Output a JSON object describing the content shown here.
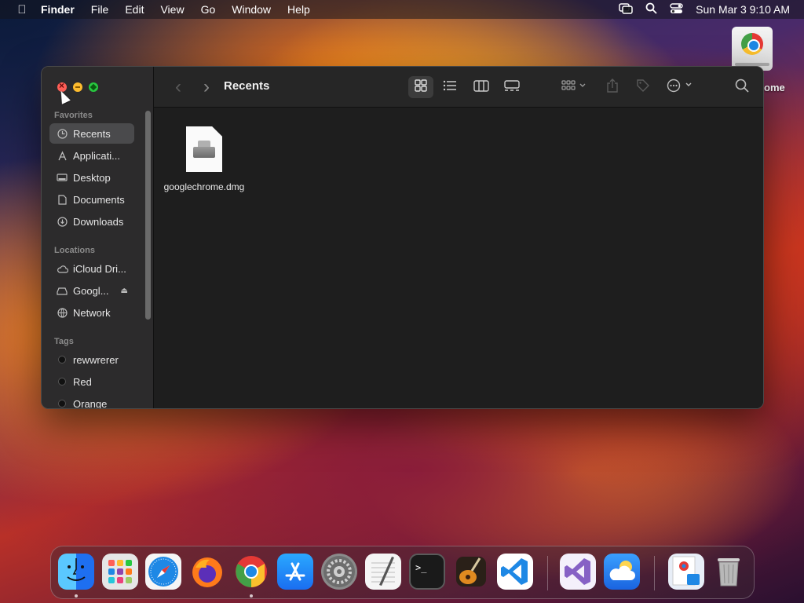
{
  "menubar": {
    "apple_icon": "apple-icon",
    "app_name": "Finder",
    "items": [
      "File",
      "Edit",
      "View",
      "Go",
      "Window",
      "Help"
    ],
    "status_icons": [
      "windows-icon",
      "search-icon",
      "control-center-icon"
    ],
    "clock": "Sun Mar 3  9:10 AM"
  },
  "desktop": {
    "icon_label": "rome",
    "icon": "googlechrome-disk-icon"
  },
  "finder": {
    "title": "Recents",
    "sidebar": {
      "favorites_header": "Favorites",
      "favorites": [
        {
          "label": "Recents",
          "icon": "clock-icon"
        },
        {
          "label": "Applicati...",
          "icon": "applications-icon"
        },
        {
          "label": "Desktop",
          "icon": "desktop-icon"
        },
        {
          "label": "Documents",
          "icon": "document-icon"
        },
        {
          "label": "Downloads",
          "icon": "downloads-icon"
        }
      ],
      "locations_header": "Locations",
      "locations": [
        {
          "label": "iCloud Dri...",
          "icon": "cloud-icon"
        },
        {
          "label": "Googl...",
          "icon": "disk-icon",
          "eject": "eject-icon"
        },
        {
          "label": "Network",
          "icon": "network-icon"
        }
      ],
      "tags_header": "Tags",
      "tags": [
        {
          "label": "rewwrerer",
          "color": "#1a1a1a"
        },
        {
          "label": "Red",
          "color": "#1a1a1a"
        },
        {
          "label": "Orange",
          "color": "#1a1a1a"
        }
      ]
    },
    "toolbar": {
      "back": "‹",
      "forward": "›",
      "view_buttons": [
        "icon-view-icon",
        "list-view-icon",
        "column-view-icon",
        "gallery-view-icon"
      ],
      "group_icon": "group-icon",
      "share_icon": "share-icon",
      "tag_icon": "tag-icon",
      "more_icon": "more-icon",
      "search_icon": "search-icon"
    },
    "files": [
      {
        "name": "googlechrome.dmg",
        "icon": "dmg-file-icon"
      }
    ]
  },
  "dock": {
    "apps": [
      {
        "name": "Finder",
        "running": true,
        "color": "#1e7cf2"
      },
      {
        "name": "Launchpad",
        "running": false,
        "color": "#d9d9d9"
      },
      {
        "name": "Safari",
        "running": false,
        "color": "#2a8cf5"
      },
      {
        "name": "Firefox",
        "running": false,
        "color": "#ff7a1a"
      },
      {
        "name": "Google Chrome",
        "running": true,
        "color": "#ffffff"
      },
      {
        "name": "App Store",
        "running": false,
        "color": "#1b8cf5"
      },
      {
        "name": "System Settings",
        "running": false,
        "color": "#8a8a8a"
      },
      {
        "name": "TextEdit",
        "running": false,
        "color": "#f5f5f5"
      },
      {
        "name": "Terminal",
        "running": false,
        "color": "#1a1a1a"
      },
      {
        "name": "GarageBand",
        "running": false,
        "color": "#3a2a1a"
      },
      {
        "name": "Visual Studio Code",
        "running": false,
        "color": "#ffffff"
      },
      {
        "name": "Visual Studio",
        "running": false,
        "color": "#f4f0fb"
      },
      {
        "name": "Weather",
        "running": false,
        "color": "#1e7cf2"
      },
      {
        "name": "Chrome Installer",
        "running": false,
        "color": "#e8eef7"
      },
      {
        "name": "Trash",
        "running": false,
        "color": "#b8b8b8"
      }
    ]
  }
}
